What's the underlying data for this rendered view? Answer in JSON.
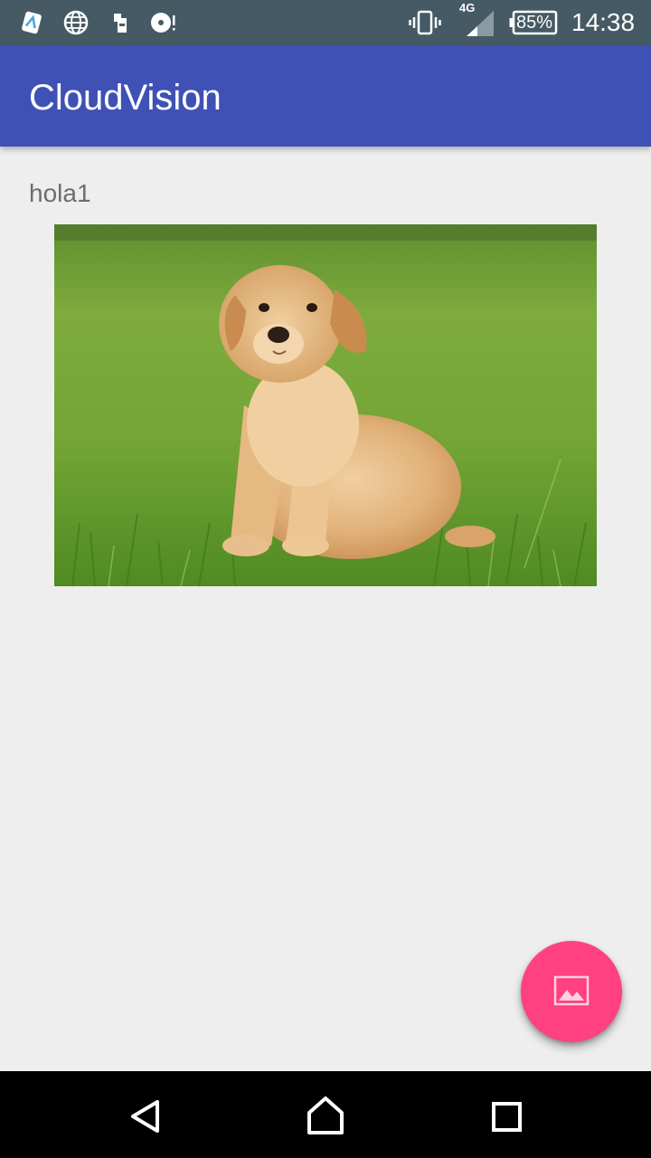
{
  "status_bar": {
    "network_label": "4G",
    "battery": "85%",
    "time": "14:38",
    "icons": [
      "notification-app-icon",
      "globe-icon",
      "sd-card-icon",
      "media-disc-icon",
      "vibrate-icon",
      "signal-icon",
      "battery-icon"
    ]
  },
  "app_bar": {
    "title": "CloudVision",
    "color": "#3f51b5"
  },
  "main": {
    "result_text": "hola1",
    "image": {
      "subject": "puppy-photo"
    }
  },
  "fab": {
    "icon": "image-gallery-icon",
    "color": "#ff4081"
  },
  "nav_bar": {
    "buttons": [
      "back-icon",
      "home-icon",
      "recents-icon"
    ]
  }
}
